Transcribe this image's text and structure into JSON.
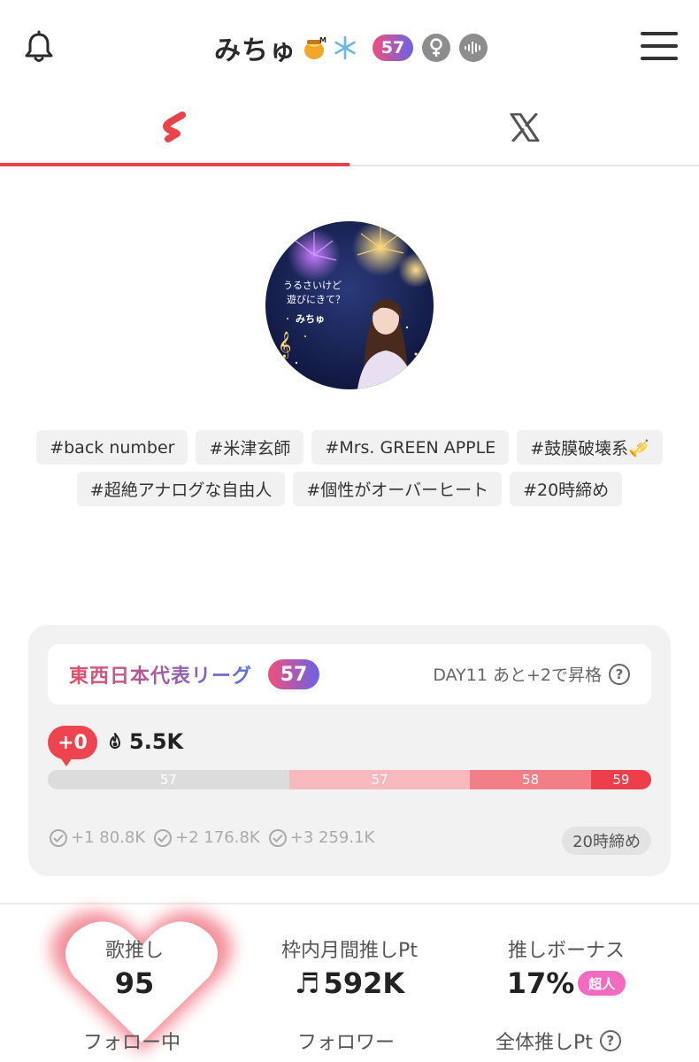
{
  "header": {
    "title": "みちゅ",
    "title_emoji_1": "honey-pot-icon",
    "title_emoji_2": "snowflake-icon",
    "level": "57",
    "gender": "♀",
    "accent": "#e8424a"
  },
  "tabs": [
    {
      "name": "app-logo",
      "active": true
    },
    {
      "name": "x-logo",
      "active": false
    }
  ],
  "tags": [
    "#back number",
    "#米津玄師",
    "#Mrs. GREEN APPLE",
    "#鼓膜破壊系🎺",
    "#超絶アナログな自由人",
    "#個性がオーバーヒート",
    "#20時締め"
  ],
  "avatar": {
    "overlay_text_1": "うるさいけど",
    "overlay_text_2": "遊びにきて？",
    "overlay_name": "みちゅ"
  },
  "league": {
    "name": "東西日本代表リーグ",
    "level": "57",
    "day_info": "DAY11 あと+2で昇格",
    "help": "?",
    "delta": "+0",
    "points": "5.5K",
    "progress_segments": [
      {
        "label": "57",
        "share": 0.4,
        "color": "#dcdcdc"
      },
      {
        "label": "57",
        "share": 0.3,
        "color": "#f7b9bd"
      },
      {
        "label": "58",
        "share": 0.2,
        "color": "#f27f87"
      },
      {
        "label": "59",
        "share": 0.1,
        "color": "#ee3e4c"
      }
    ],
    "thresholds": [
      "+1 80.8K",
      "+2 176.8K",
      "+3 259.1K"
    ],
    "deadline": "20時締め"
  },
  "stats": {
    "song_push_label": "歌推し",
    "song_push_value": "95",
    "monthly_label": "枠内月間推しPt",
    "monthly_value": "592K",
    "monthly_prefix": "♬",
    "bonus_label": "推しボーナス",
    "bonus_value": "17%",
    "bonus_badge": "超人",
    "following_label": "フォロー中",
    "followers_label": "フォロワー",
    "total_label": "全体推しPt",
    "total_help": "?"
  }
}
